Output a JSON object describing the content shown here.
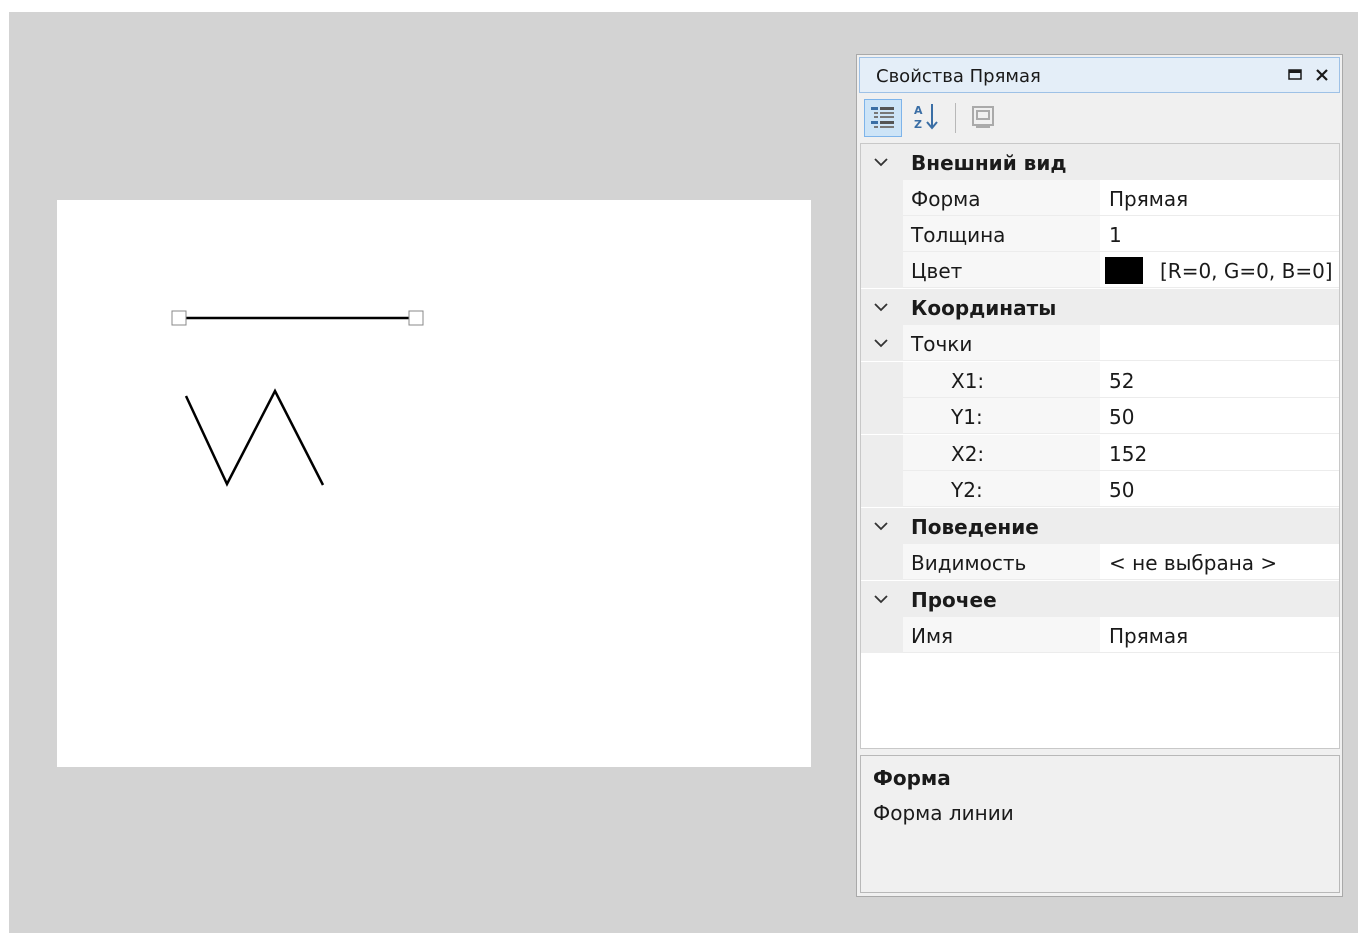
{
  "panel": {
    "title": "Свойства Прямая",
    "buttons": {
      "maximize_icon": "maximize-icon",
      "close_icon": "close-icon"
    }
  },
  "toolbar": {
    "icons": [
      "categorized-icon",
      "sort-alpha-icon",
      "property-pages-icon"
    ]
  },
  "grid": {
    "appearance": {
      "label": "Внешний вид",
      "shape": {
        "name": "Форма",
        "value": "Прямая"
      },
      "thickness": {
        "name": "Толщина",
        "value": "1"
      },
      "color": {
        "name": "Цвет",
        "value": "[R=0, G=0, B=0]",
        "swatch": "#000000"
      }
    },
    "coordinates": {
      "label": "Координаты",
      "points": {
        "name": "Точки",
        "x1": {
          "name": "X1:",
          "value": "52"
        },
        "y1": {
          "name": "Y1:",
          "value": "50"
        },
        "x2": {
          "name": "X2:",
          "value": "152"
        },
        "y2": {
          "name": "Y2:",
          "value": "50"
        }
      }
    },
    "behavior": {
      "label": "Поведение",
      "visibility": {
        "name": "Видимость",
        "value": "< не выбрана >"
      }
    },
    "other": {
      "label": "Прочее",
      "name": {
        "name": "Имя",
        "value": "Прямая"
      }
    }
  },
  "description": {
    "title": "Форма",
    "text": "Форма линии"
  },
  "colors": {
    "workspace": "#d3d3d3",
    "header": "#e4eef8",
    "selected_button": "#cde4f7",
    "line": "#000000"
  }
}
